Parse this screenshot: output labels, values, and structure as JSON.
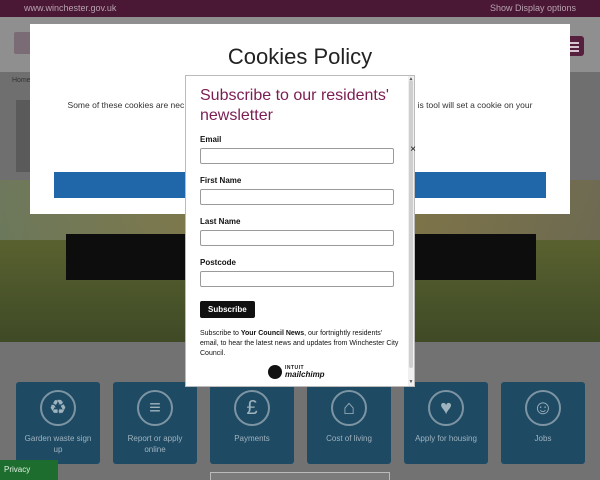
{
  "topbar": {
    "site": "www.winchester.gov.uk",
    "display_options": "Show Display options"
  },
  "breadcrumb": "Home",
  "cookies": {
    "title": "Cookies Policy",
    "line1": "T                                                                                                    r.",
    "para": "Some of these cookies are nec                                                                  cookies to help improve your experience on the site. You can                                                               is tool will set a cookie on your device to rem                                                                 d at any time."
  },
  "modal": {
    "title": "Subscribe to our residents' newsletter",
    "email_label": "Email",
    "first_name_label": "First Name",
    "last_name_label": "Last Name",
    "postcode_label": "Postcode",
    "subscribe_label": "Subscribe",
    "desc_prefix": "Subscribe to ",
    "desc_bold": "Your Council News",
    "desc_suffix": ", our fortnightly residents' email, to hear the latest news and updates from Winchester City Council.",
    "brand_top": "INTUIT",
    "brand_main": "mailchimp",
    "close": "×"
  },
  "tiles": [
    {
      "label": "Garden waste sign up",
      "icon": "garden-waste-icon",
      "glyph": "♻"
    },
    {
      "label": "Report or apply online",
      "icon": "form-icon",
      "glyph": "≡"
    },
    {
      "label": "Payments",
      "icon": "pound-icon",
      "glyph": "£"
    },
    {
      "label": "Cost of living",
      "icon": "house-pound-icon",
      "glyph": "⌂"
    },
    {
      "label": "Apply for housing",
      "icon": "house-heart-icon",
      "glyph": "♥"
    },
    {
      "label": "Jobs",
      "icon": "people-icon",
      "glyph": "☺"
    }
  ],
  "privacy": "Privacy settings"
}
